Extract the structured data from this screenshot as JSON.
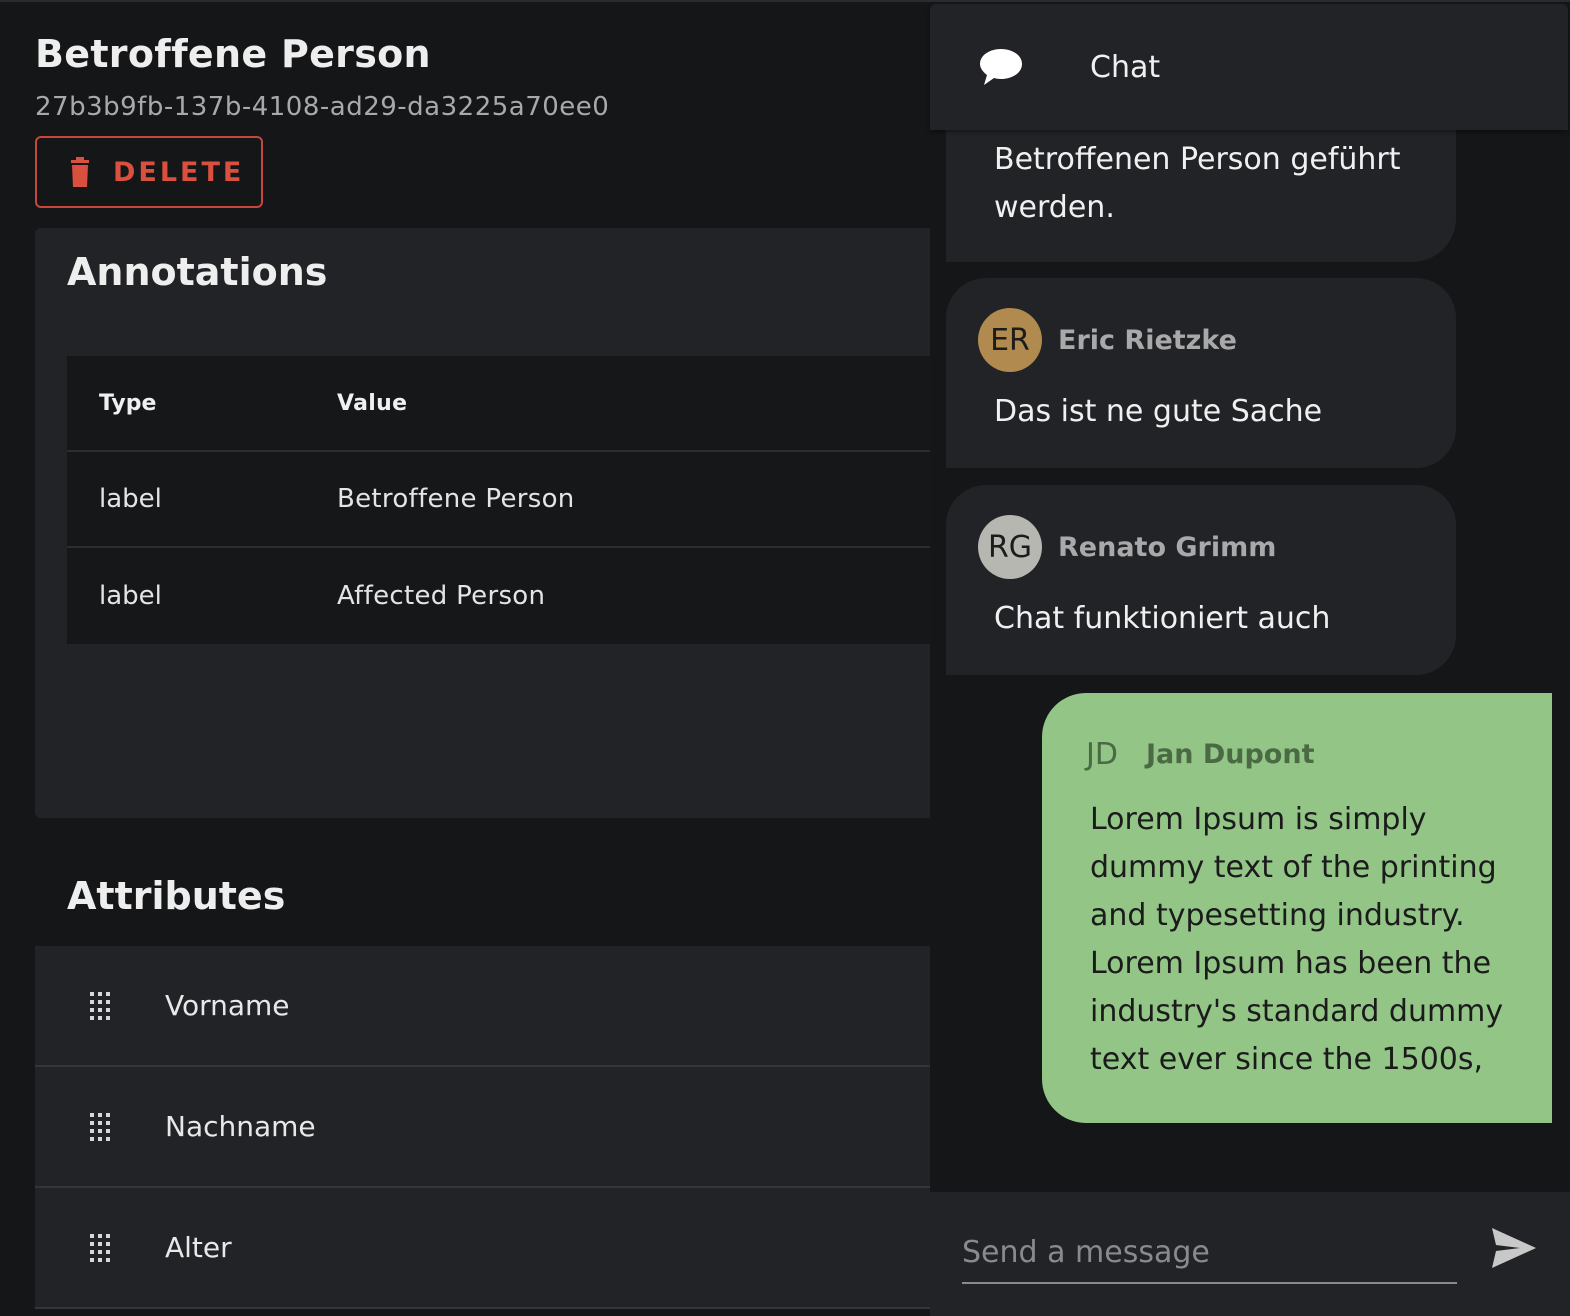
{
  "entity": {
    "title": "Betroffene Person",
    "id": "27b3b9fb-137b-4108-ad29-da3225a70ee0",
    "delete_label": "DELETE"
  },
  "annotations": {
    "title": "Annotations",
    "columns": [
      "Type",
      "Value"
    ],
    "rows": [
      {
        "type": "label",
        "value": "Betroffene Person"
      },
      {
        "type": "label",
        "value": "Affected Person"
      }
    ]
  },
  "attributes": {
    "title": "Attributes",
    "items": [
      {
        "name": "Vorname"
      },
      {
        "name": "Nachname"
      },
      {
        "name": "Alter"
      }
    ]
  },
  "chat": {
    "title": "Chat",
    "messages": [
      {
        "text": "Betroffenen Person geführt werden."
      },
      {
        "initials": "ER",
        "author": "Eric Rietzke",
        "text": "Das ist ne gute Sache",
        "avatar_color": "#b08a4e"
      },
      {
        "initials": "RG",
        "author": "Renato Grimm",
        "text": "Chat funktioniert auch",
        "avatar_color": "#b7b7b2"
      },
      {
        "initials": "JD",
        "author": "Jan Dupont",
        "text": "Lorem Ipsum is simply dummy text of the printing and typesetting industry. Lorem Ipsum has been the industry's standard dummy text ever since the 1500s,",
        "bubble_color": "#93c587"
      }
    ],
    "composer_placeholder": "Send a message"
  },
  "colors": {
    "background": "#151618",
    "surface": "#222326",
    "danger": "#d9503f",
    "own_message": "#93c587"
  }
}
